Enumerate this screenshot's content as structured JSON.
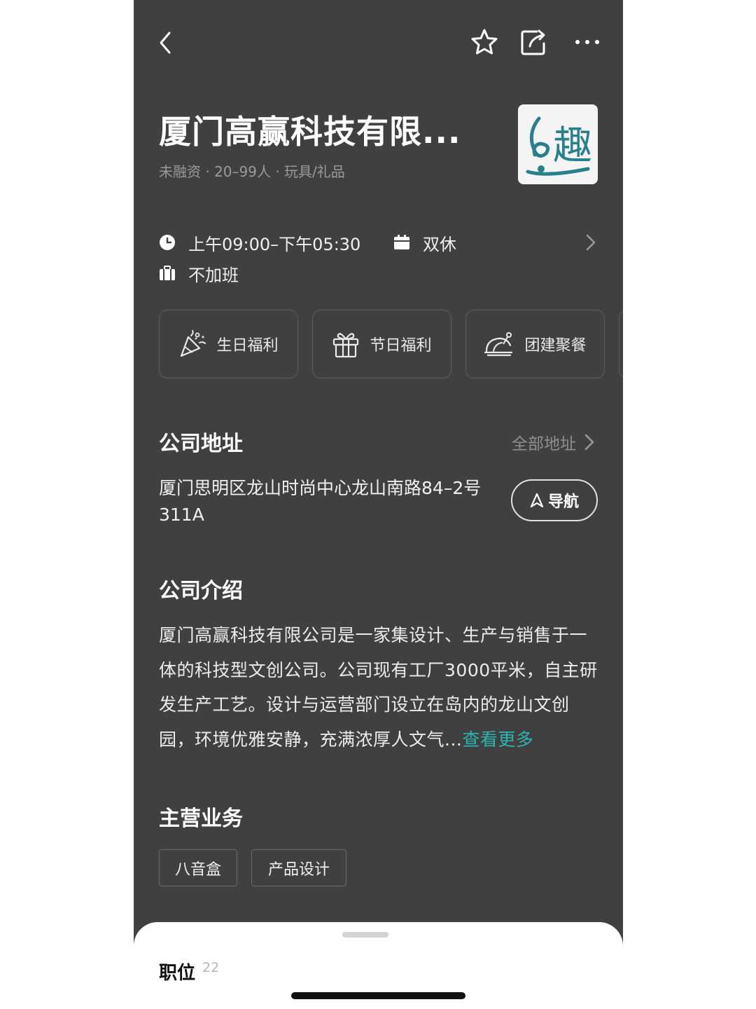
{
  "header": {
    "company_name": "厦门高赢科技有限...",
    "meta": "未融资 · 20–99人 · 玩具/礼品",
    "logo_char": "趣"
  },
  "topbar": {
    "icons": [
      "back-icon",
      "star-icon",
      "share-icon",
      "more-icon"
    ]
  },
  "work_info": {
    "hours": "上午09:00–下午05:30",
    "rest": "双休",
    "overtime": "不加班"
  },
  "welfare": [
    {
      "label": "生日福利",
      "icon": "party-popper-icon"
    },
    {
      "label": "节日福利",
      "icon": "gift-icon"
    },
    {
      "label": "团建聚餐",
      "icon": "dinner-icon"
    }
  ],
  "address_section": {
    "title": "公司地址",
    "all_label": "全部地址",
    "address": "厦门思明区龙山时尚中心龙山南路84–2号311A",
    "nav_label": "导航"
  },
  "intro_section": {
    "title": "公司介绍",
    "text": "厦门高赢科技有限公司是一家集设计、生产与销售于一体的科技型文创公司。公司现有工厂3000平米，自主研发生产工艺。设计与运营部门设立在岛内的龙山文创园，环境优雅安静，充满浓厚人文气...",
    "more_label": "查看更多"
  },
  "business_section": {
    "title": "主营业务",
    "tags": [
      "八音盒",
      "产品设计"
    ]
  },
  "bottom_sheet": {
    "title": "职位",
    "count": "22"
  },
  "colors": {
    "background": "#404040",
    "accent": "#2bb5b0",
    "logo_teal": "#2a7f8c"
  }
}
